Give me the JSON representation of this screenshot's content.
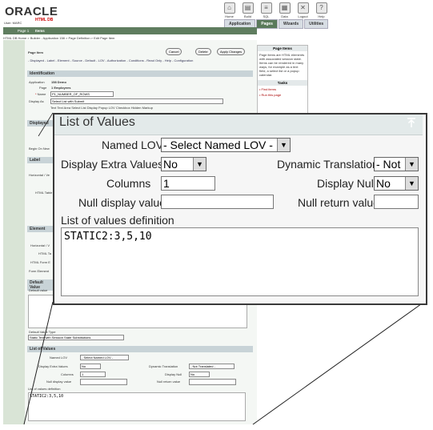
{
  "header": {
    "logo": "ORACLE",
    "logo_sub": "HTML DB",
    "user": "User: MARC",
    "icons": [
      {
        "label": "Home",
        "icon": "home-icon",
        "glyph": "⌂"
      },
      {
        "label": "Build",
        "icon": "build-icon",
        "glyph": "▤"
      },
      {
        "label": "SQL",
        "icon": "sql-icon",
        "glyph": "≡"
      },
      {
        "label": "Data",
        "icon": "data-icon",
        "glyph": "▦"
      },
      {
        "label": "Logout",
        "icon": "logout-icon",
        "glyph": "✕"
      },
      {
        "label": "Help",
        "icon": "help-icon",
        "glyph": "?"
      }
    ],
    "tabs": [
      "Application",
      "Pages",
      "Wizards",
      "Utilities"
    ],
    "active_tab": 1
  },
  "nav": {
    "page": "Page 1",
    "items": "Items"
  },
  "breadcrumb": "HTML DB Home > Builder - Application 158 > Page Definition > Edit Page Item",
  "page_item": {
    "title": "Page Item",
    "cancel": "Cancel",
    "delete": "Delete",
    "apply": "Apply Changes",
    "links": "- Displayed - Label - Element - Source - Default - LOV - Authorization - Conditions - Read Only - Help - Configuration"
  },
  "right_panel": {
    "title": "Page Items",
    "text": "Page items are HTML elements with associated session state. Items can be rendered in many ways, for example as a text field, a select list or a popup calendar.",
    "tasks_title": "Tasks",
    "tasks": [
      "Find items",
      "Run this page"
    ]
  },
  "identification": {
    "title": "Identification",
    "application_label": "Application",
    "application": "158 Demo",
    "page_label": "Page",
    "page": "1 Employees",
    "name_label": "Name",
    "name": "P1_NUMBER_OF_ROWS",
    "display_as_label": "Display As",
    "display_as": "Select List with Submit",
    "radio_opts": [
      "Text",
      "Text Area",
      "Select List",
      "Display",
      "Popup LOV",
      "Checkbox",
      "Hidden",
      "Markup"
    ]
  },
  "sections_bg": {
    "displayed": "Displayed",
    "begin_on_new": "Begin On New",
    "label": "Label",
    "horizontal": "Horizontal / Ve",
    "html_table": "HTML Table",
    "element": "Element",
    "horizontal2": "Horizontal / V",
    "html_table2": "HTML Ta",
    "html_form": "HTML Form E",
    "form_element": "Form Element",
    "default_value": "Default Value",
    "default_value_label": "Default value",
    "default_value_type_label": "Default Value Type",
    "default_value_type": "Static Text with Session State Substitutions"
  },
  "lov_small": {
    "title": "List of Values",
    "named_lov_label": "Named LOV",
    "named_lov": "- Select Named LOV -",
    "display_extra_label": "Display Extra Values",
    "display_extra": "No",
    "dynamic_translation_label": "Dynamic Translation",
    "dynamic_translation": "- Not Translated -",
    "columns_label": "Columns",
    "columns": "1",
    "display_null_label": "Display Null",
    "display_null": "No",
    "null_display_label": "Null display value",
    "null_return_label": "Null return value",
    "definition_label": "List of values definition",
    "definition": "STATIC2:3,5,10"
  },
  "lov_popup": {
    "title": "List of Values",
    "named_lov_label": "Named LOV",
    "named_lov": "- Select Named LOV -",
    "display_extra_label": "Display Extra Values",
    "display_extra": "No",
    "dynamic_translation_label": "Dynamic Translation",
    "dynamic_translation": "- Not",
    "columns_label": "Columns",
    "columns": "1",
    "display_null_label": "Display Null",
    "display_null": "No",
    "null_display_label": "Null display value",
    "null_display": "",
    "null_return_label": "Null return value",
    "null_return": "",
    "definition_label": "List of values definition",
    "definition": "STATIC2:3,5,10"
  }
}
